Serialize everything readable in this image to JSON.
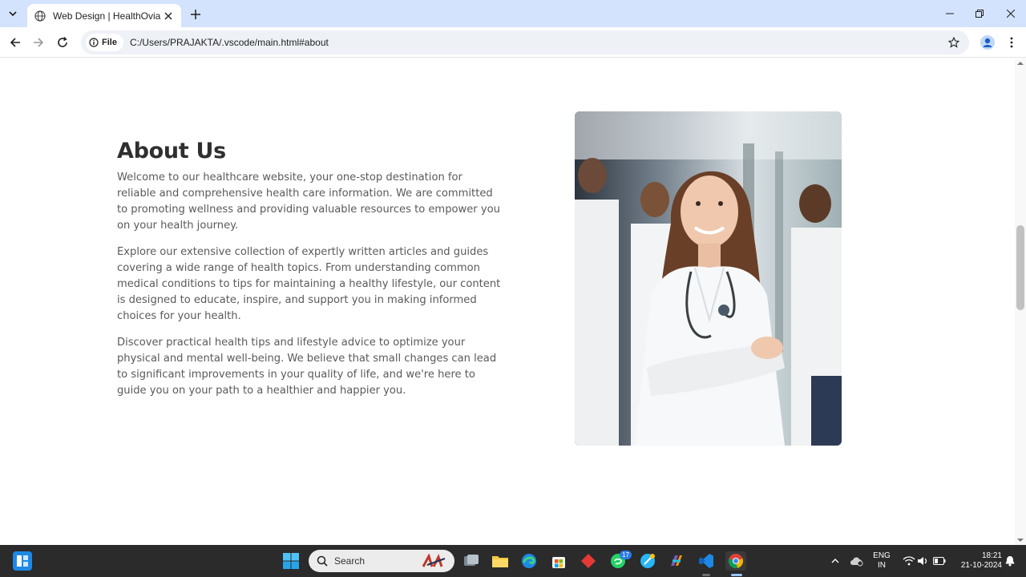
{
  "browser": {
    "tab_title": "Web Design | HealthOvia",
    "address_chip": "File",
    "url": "C:/Users/PRAJAKTA/.vscode/main.html#about"
  },
  "about": {
    "heading": "About Us",
    "paragraphs": [
      "Welcome to our healthcare website, your one-stop destination for reliable and comprehensive health care information. We are committed to promoting wellness and providing valuable resources to empower you on your health journey.",
      "Explore our extensive collection of expertly written articles and guides covering a wide range of health topics. From understanding common medical conditions to tips for maintaining a healthy lifestyle, our content is designed to educate, inspire, and support you in making informed choices for your health.",
      "Discover practical health tips and lifestyle advice to optimize your physical and mental well-being. We believe that small changes can lead to significant improvements in your quality of life, and we're here to guide you on your path to a healthier and happier you."
    ]
  },
  "taskbar": {
    "search_label": "Search",
    "whatsapp_badge": "17",
    "lang_top": "ENG",
    "lang_bottom": "IN",
    "time": "18:21",
    "date": "21-10-2024"
  },
  "colors": {
    "tabstrip": "#d3e3fd",
    "heading": "#2f2f2f",
    "body_text": "#5a5a5a",
    "taskbar": "#2b2b2b"
  }
}
